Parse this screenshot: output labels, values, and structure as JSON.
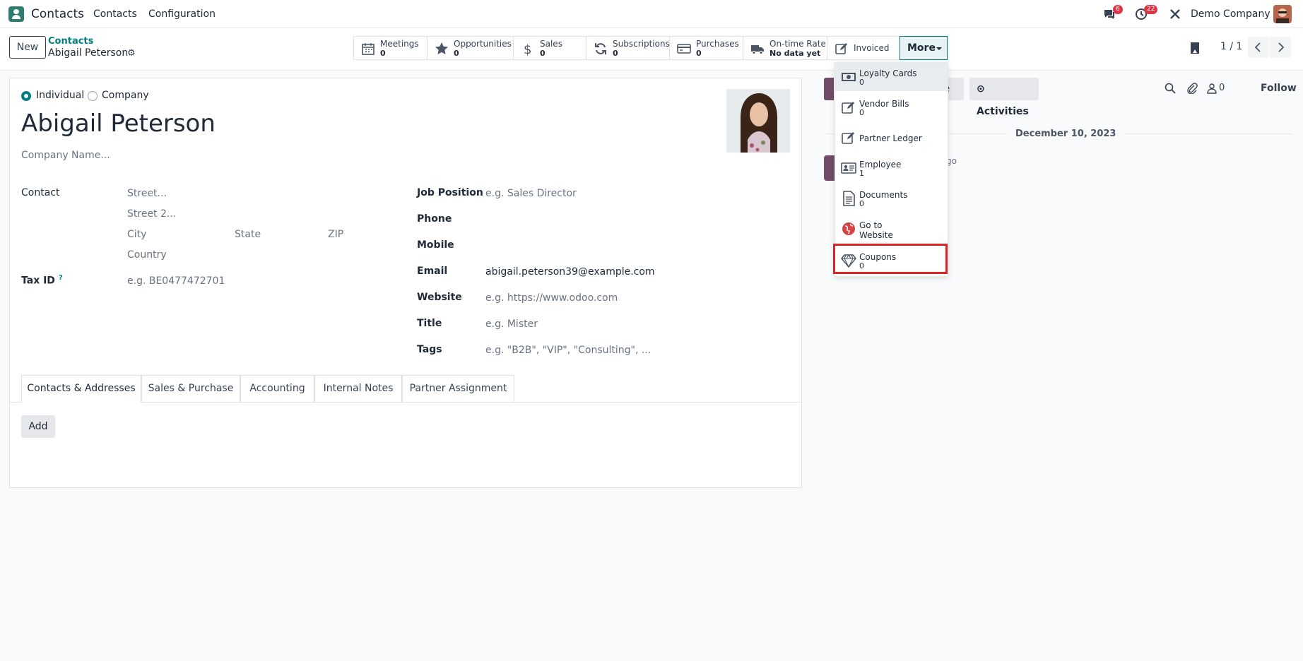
{
  "nav": {
    "app": "Contacts",
    "menu": [
      "Contacts",
      "Configuration"
    ],
    "chat_badge": "6",
    "activity_badge": "22",
    "company": "Demo Company"
  },
  "control": {
    "new_label": "New",
    "breadcrumb": "Contacts",
    "current": "Abigail Peterson",
    "pager": "1 / 1",
    "more_label": "More"
  },
  "stats": [
    {
      "label": "Meetings",
      "value": "0"
    },
    {
      "label": "Opportunities",
      "value": "0"
    },
    {
      "label": "Sales",
      "value": "0"
    },
    {
      "label": "Subscriptions",
      "value": "0"
    },
    {
      "label": "Purchases",
      "value": "0"
    },
    {
      "label": "On-time Rate",
      "value": "No data yet"
    },
    {
      "label": "Invoiced"
    }
  ],
  "form": {
    "type_options": [
      "Individual",
      "Company"
    ],
    "name": "Abigail Peterson",
    "company_placeholder": "Company Name...",
    "contact_label": "Contact",
    "street_ph": "Street...",
    "street2_ph": "Street 2...",
    "city_ph": "City",
    "state_ph": "State",
    "zip_ph": "ZIP",
    "country_ph": "Country",
    "tax_label": "Tax ID",
    "tax_help": "?",
    "tax_ph": "e.g. BE0477472701",
    "job_label": "Job Position",
    "job_ph": "e.g. Sales Director",
    "phone_label": "Phone",
    "mobile_label": "Mobile",
    "email_label": "Email",
    "email_value": "abigail.peterson39@example.com",
    "website_label": "Website",
    "website_ph": "e.g. https://www.odoo.com",
    "title_label": "Title",
    "title_ph": "e.g. Mister",
    "tags_label": "Tags",
    "tags_ph": "e.g. \"B2B\", \"VIP\", \"Consulting\", ...",
    "tabs": [
      "Contacts & Addresses",
      "Sales & Purchase",
      "Accounting",
      "Internal Notes",
      "Partner Assignment"
    ],
    "add_label": "Add"
  },
  "chatter": {
    "partial_btn": "te",
    "activities_label": "Activities",
    "followers": "0",
    "follow_label": "Follow",
    "date": "December 10, 2023",
    "ago": "go"
  },
  "dropdown": [
    {
      "label": "Loyalty Cards",
      "value": "0",
      "icon": "money-icon"
    },
    {
      "label": "Vendor Bills",
      "value": "0",
      "icon": "pencil-square-icon"
    },
    {
      "label": "Partner Ledger",
      "icon": "pencil-square-icon"
    },
    {
      "label": "Employee",
      "value": "1",
      "icon": "id-card-icon"
    },
    {
      "label": "Documents",
      "value": "0",
      "icon": "file-text-icon"
    },
    {
      "label": "Go to",
      "label2": "Website",
      "icon": "globe-icon"
    },
    {
      "label": "Coupons",
      "value": "0",
      "icon": "diamond-icon"
    }
  ],
  "colors": {
    "brand": "#714b67",
    "accent": "#017e84",
    "highlight_box": "#dc2626"
  }
}
